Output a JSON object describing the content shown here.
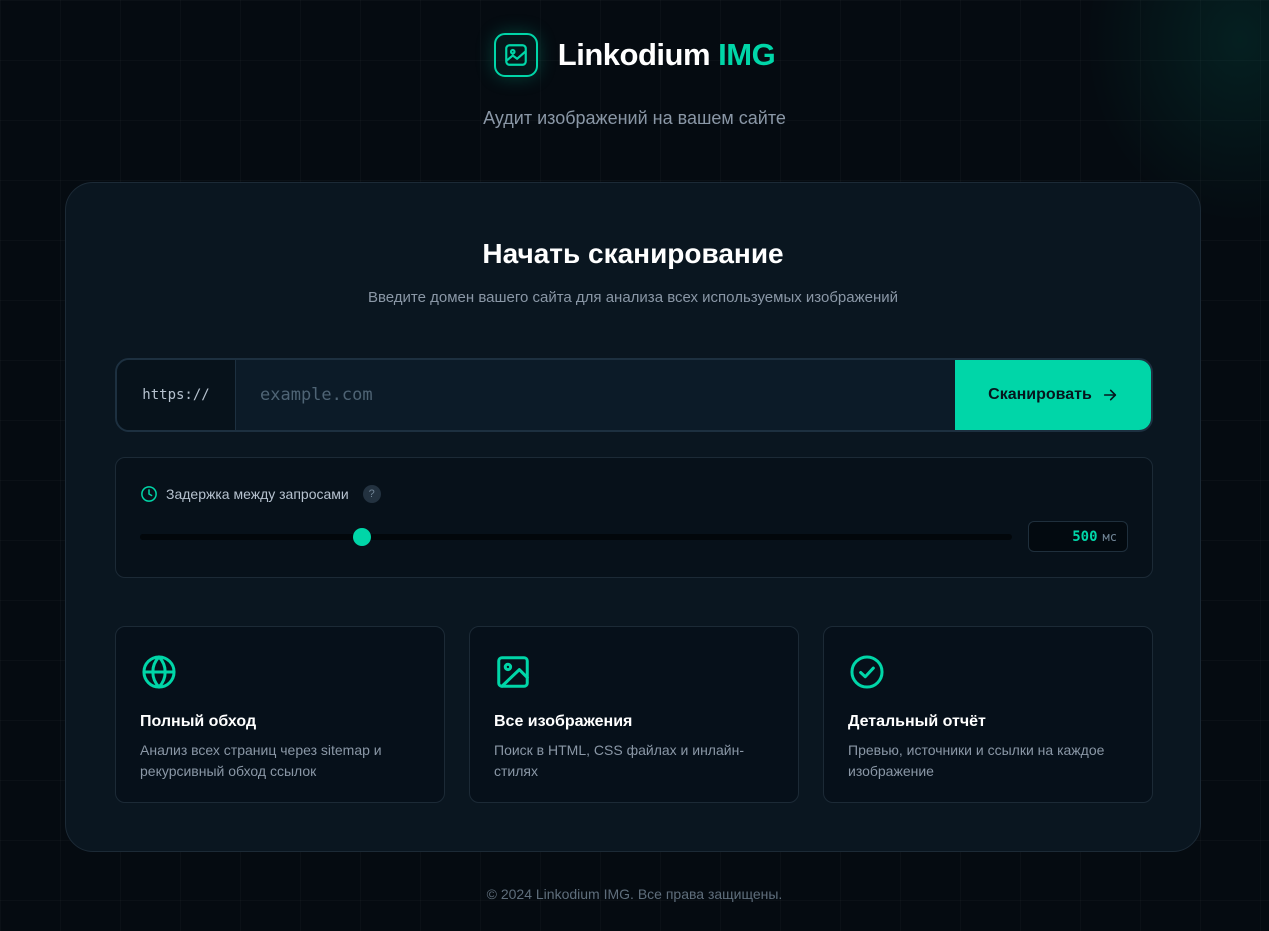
{
  "brand": {
    "name": "Linkodium",
    "accent": "IMG",
    "logo_icon": "image-chart-icon",
    "tagline": "Аудит изображений на вашем сайте"
  },
  "scan": {
    "title": "Начать сканирование",
    "subtitle": "Введите домен вашего сайта для анализа всех используемых изображений",
    "url_prefix": "https://",
    "url_value": "",
    "url_placeholder": "example.com",
    "button_label": "Сканировать",
    "button_icon": "arrow-right-icon"
  },
  "delay": {
    "label": "Задержка между запросами",
    "label_icon": "clock-icon",
    "help": "?",
    "value": "500",
    "unit": "мс",
    "slider_fraction": 0.255
  },
  "features": [
    {
      "icon": "globe-icon",
      "title": "Полный обход",
      "description": "Анализ всех страниц через sitemap и рекурсивный обход ссылок"
    },
    {
      "icon": "image-icon",
      "title": "Все изображения",
      "description": "Поиск в HTML, CSS файлах и инлайн-стилях"
    },
    {
      "icon": "check-circle-icon",
      "title": "Детальный отчёт",
      "description": "Превью, источники и ссылки на каждое изображение"
    }
  ],
  "footer": {
    "text": "© 2024 Linkodium IMG. Все права защищены."
  },
  "colors": {
    "accent": "#00d6a8",
    "background": "#050b11",
    "card": "#0a1620",
    "muted_text": "#8a97a6"
  }
}
